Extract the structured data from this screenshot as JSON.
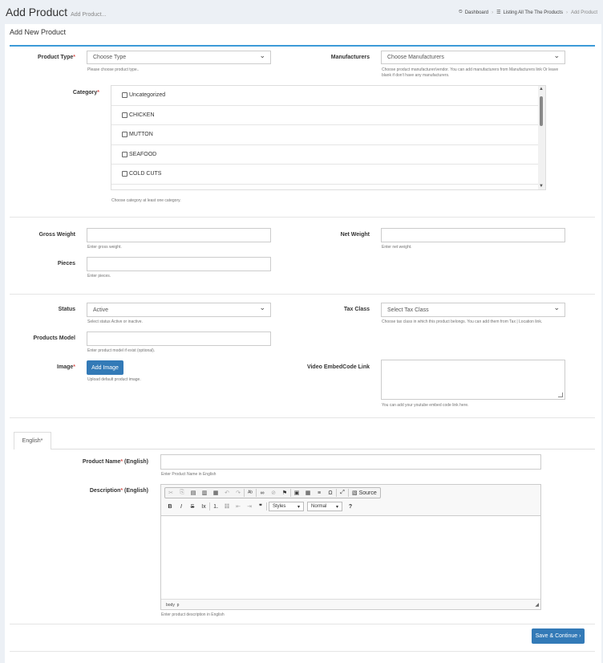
{
  "header": {
    "title": "Add Product",
    "subtitle": "Add Product...",
    "breadcrumb": {
      "dashboard": "Dashboard",
      "listing": "Listing All The The Products",
      "current": "Add Product"
    }
  },
  "box": {
    "title": "Add New Product"
  },
  "form": {
    "product_type": {
      "label": "Product Type",
      "value": "Choose Type",
      "help": "Please choose product type.."
    },
    "manufacturers": {
      "label": "Manufacturers",
      "value": "Choose Manufacturers",
      "help": "Choose product manufacturer/vendor. You can add manufacturers from Manufacturers link Or leave blank if don't have any manufacturers."
    },
    "category": {
      "label": "Category",
      "items": [
        "Uncategorized",
        "CHICKEN",
        "MUTTON",
        "SEAFOOD",
        "COLD CUTS"
      ],
      "help": "Choose category at least one category."
    },
    "gross_weight": {
      "label": "Gross Weight",
      "value": "",
      "help": "Enter gross weight."
    },
    "net_weight": {
      "label": "Net Weight",
      "value": "",
      "help": "Enter net weight."
    },
    "pieces": {
      "label": "Pieces",
      "value": "",
      "help": "Enter pieces."
    },
    "status": {
      "label": "Status",
      "value": "Active",
      "help": "Select status Active or inactive."
    },
    "tax_class": {
      "label": "Tax Class",
      "value": "Select Tax Class",
      "help": "Choose tax class in which this product belongs. You can add them from Tax | Location link."
    },
    "products_model": {
      "label": "Products Model",
      "value": "",
      "help": "Enter product model if exist (optional)."
    },
    "image": {
      "label": "Image",
      "button": "Add Image",
      "help": "Upload default product image."
    },
    "video": {
      "label": "Video EmbedCode Link",
      "value": "",
      "help": "You can add your youtube embed code link here."
    },
    "tab_english": "English*",
    "product_name": {
      "label_main": "Product Name",
      "label_lang": " (English)",
      "value": "",
      "help": "Enter Product Name in English"
    },
    "description": {
      "label_main": "Description",
      "label_lang": " (English)",
      "help": "Enter product description in English"
    },
    "editor": {
      "source_label": "Source",
      "styles_label": "Styles",
      "format_label": "Normal",
      "path_body": "body",
      "path_p": "p"
    },
    "submit_label": "Save & Continue ›"
  },
  "colors": {
    "accent": "#3c9ad8",
    "button": "#337ab7",
    "required": "#d9534f"
  }
}
